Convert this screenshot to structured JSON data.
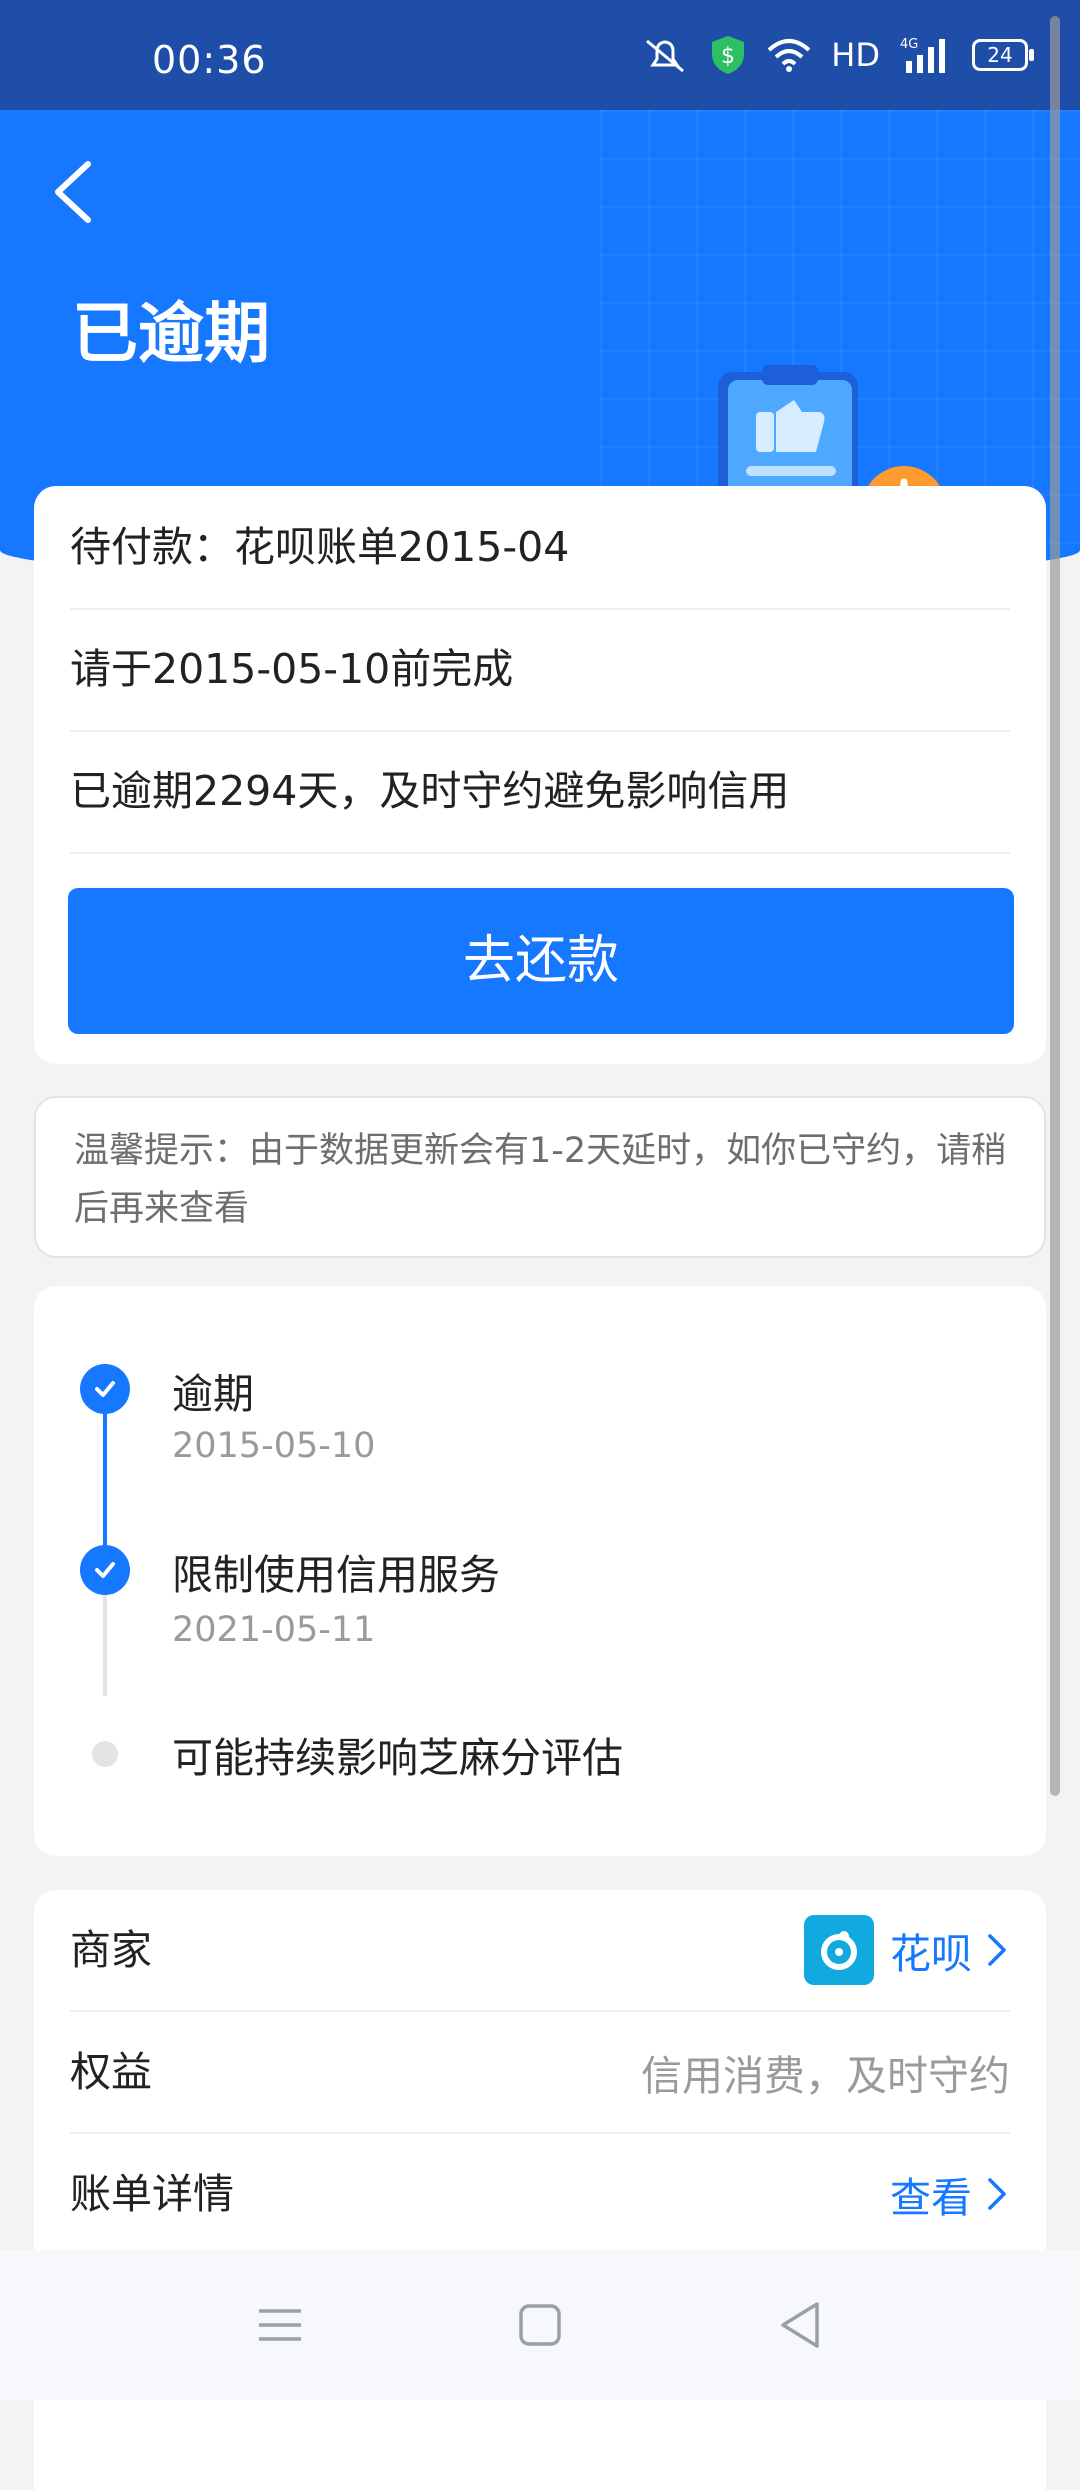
{
  "status_bar": {
    "time": "00:36",
    "network_label": "HD",
    "cell_label": "4G",
    "battery": "24"
  },
  "header": {
    "title": "已逾期"
  },
  "bill": {
    "pending": "待付款：花呗账单2015-04",
    "deadline": "请于2015-05-10前完成",
    "overdue": "已逾期2294天，及时守约避免影响信用",
    "pay_button": "去还款"
  },
  "tip": {
    "text": "温馨提示：由于数据更新会有1-2天延时，如你已守约，请稍后再来查看"
  },
  "timeline": [
    {
      "title": "逾期",
      "date": "2015-05-10",
      "done": true
    },
    {
      "title": "限制使用信用服务",
      "date": "2021-05-11",
      "done": true
    },
    {
      "title": "可能持续影响芝麻分评估",
      "date": "",
      "done": false
    }
  ],
  "info": {
    "merchant_label": "商家",
    "merchant_value": "花呗",
    "rights_label": "权益",
    "rights_value": "信用消费，及时守约",
    "detail_label": "账单详情",
    "detail_value": "查看"
  },
  "colors": {
    "primary": "#1677ff",
    "status_bar": "#1e4ea8",
    "clock_orange": "#ff9a2e"
  },
  "icons": [
    "back-arrow-icon",
    "mute-icon",
    "shield-dollar-icon",
    "wifi-icon",
    "signal-icon",
    "battery-icon",
    "check-icon",
    "huabei-logo-icon",
    "chevron-right-icon",
    "menu-icon",
    "home-icon",
    "back-triangle-icon"
  ]
}
